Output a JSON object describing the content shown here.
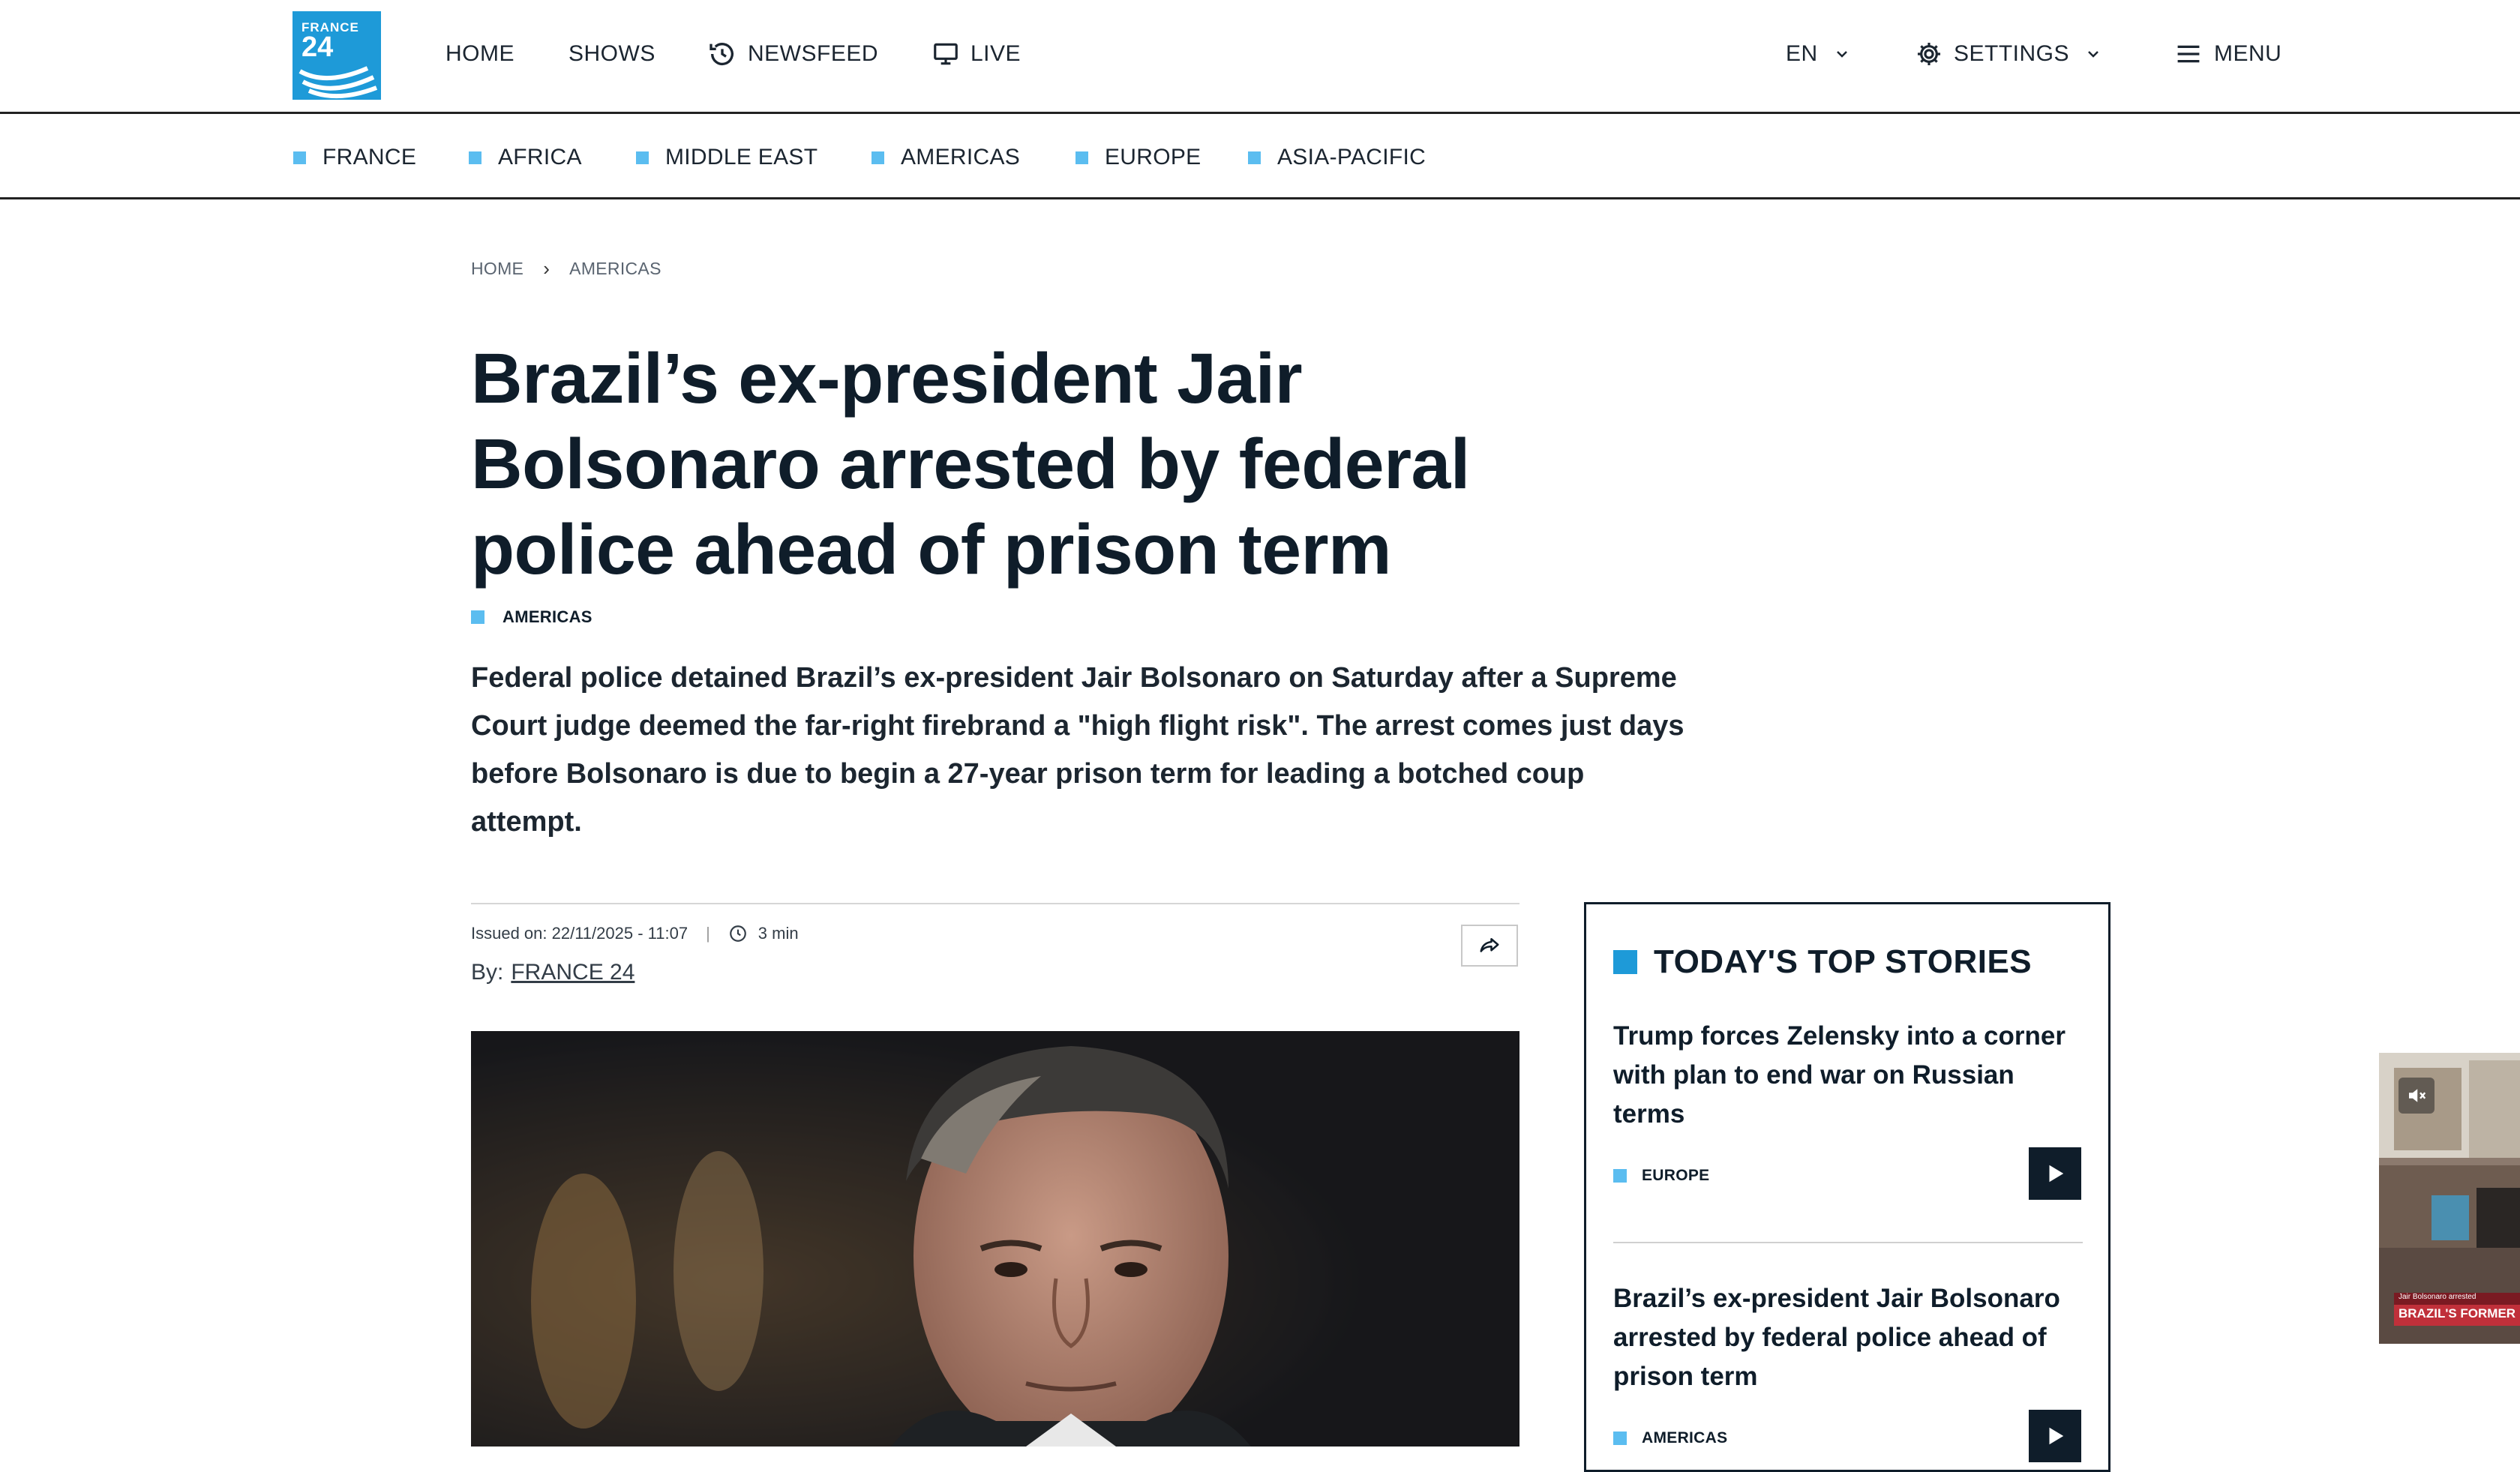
{
  "brand": {
    "logo_line1": "FRANCE",
    "logo_line2": "24"
  },
  "nav": {
    "home": "HOME",
    "shows": "SHOWS",
    "newsfeed": "NEWSFEED",
    "live": "LIVE",
    "language": "EN",
    "settings": "SETTINGS",
    "menu": "MENU"
  },
  "regions": [
    "FRANCE",
    "AFRICA",
    "MIDDLE EAST",
    "AMERICAS",
    "EUROPE",
    "ASIA-PACIFIC"
  ],
  "breadcrumb": {
    "home": "HOME",
    "section": "AMERICAS"
  },
  "article": {
    "headline": "Brazil’s ex-president Jair Bolsonaro arrested by federal police ahead of prison term",
    "tag": "AMERICAS",
    "lede": "Federal police detained Brazil’s ex-president Jair Bolsonaro on Saturday after a Supreme Court judge deemed the far-right firebrand a \"high flight risk\". The arrest comes just days before Bolsonaro is due to begin a 27-year prison term for leading a botched coup attempt.",
    "issued": "Issued on: 22/11/2025 - 11:07",
    "read_time": "3 min",
    "byline_prefix": "By:",
    "author": "FRANCE 24"
  },
  "top_stories": {
    "title": "TODAY'S TOP STORIES",
    "items": [
      {
        "title": "Trump forces Zelensky into a corner with plan to end war on Russian terms",
        "tag": "EUROPE"
      },
      {
        "title": "Brazil’s ex-president Jair Bolsonaro arrested by federal police ahead of prison term",
        "tag": "AMERICAS"
      }
    ]
  },
  "float_video": {
    "caption_small": "Jair Bolsonaro arrested",
    "caption_big": "BRAZIL'S FORMER"
  },
  "colors": {
    "accent": "#1e9ad8",
    "tag_square": "#5bbdf0",
    "ink": "#0f1d2a"
  },
  "icons": [
    "history-icon",
    "tv-icon",
    "gear-icon",
    "hamburger-icon",
    "chevron-down-icon",
    "share-icon",
    "clock-icon",
    "play-icon",
    "mute-icon"
  ]
}
